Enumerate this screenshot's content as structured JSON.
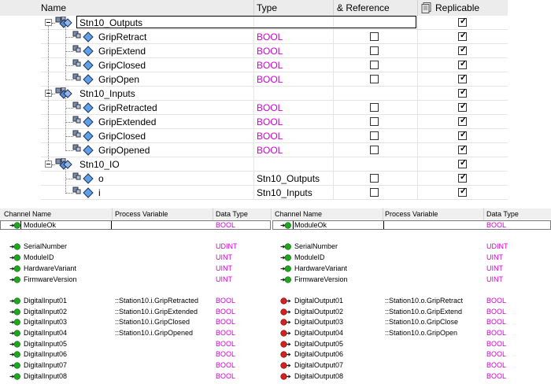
{
  "tree": {
    "headers": {
      "name": "Name",
      "type": "Type",
      "reference": "& Reference",
      "replicable": "Replicable"
    },
    "rows": [
      {
        "kind": "group",
        "name": "Stn10_Outputs",
        "type": "",
        "reference": null,
        "replicable": true,
        "editing": true
      },
      {
        "kind": "var",
        "name": "GripRetract",
        "type": "BOOL",
        "reference": false,
        "replicable": true
      },
      {
        "kind": "var",
        "name": "GripExtend",
        "type": "BOOL",
        "reference": false,
        "replicable": true
      },
      {
        "kind": "var",
        "name": "GripClosed",
        "type": "BOOL",
        "reference": false,
        "replicable": true
      },
      {
        "kind": "var",
        "name": "GripOpen",
        "type": "BOOL",
        "reference": false,
        "replicable": true
      },
      {
        "kind": "group",
        "name": "Stn10_Inputs",
        "type": "",
        "reference": null,
        "replicable": true
      },
      {
        "kind": "var",
        "name": "GripRetracted",
        "type": "BOOL",
        "reference": false,
        "replicable": true
      },
      {
        "kind": "var",
        "name": "GripExtended",
        "type": "BOOL",
        "reference": false,
        "replicable": true
      },
      {
        "kind": "var",
        "name": "GripClosed",
        "type": "BOOL",
        "reference": false,
        "replicable": true
      },
      {
        "kind": "var",
        "name": "GripOpened",
        "type": "BOOL",
        "reference": false,
        "replicable": true
      },
      {
        "kind": "group",
        "name": "Stn10_IO",
        "type": "",
        "reference": null,
        "replicable": true
      },
      {
        "kind": "var",
        "name": "o",
        "type": "Stn10_Outputs",
        "reference": false,
        "replicable": true
      },
      {
        "kind": "var",
        "name": "i",
        "type": "Stn10_Inputs",
        "reference": false,
        "replicable": true
      }
    ]
  },
  "channels": {
    "headers": {
      "channel": "Channel Name",
      "process": "Process Variable",
      "datatype": "Data Type"
    },
    "left": [
      {
        "channel": "ModuleOk",
        "process": "",
        "type": "BOOL",
        "arrow": "green-in",
        "selected": true
      },
      null,
      {
        "channel": "SerialNumber",
        "process": "",
        "type": "UDINT",
        "arrow": "green-in"
      },
      {
        "channel": "ModuleID",
        "process": "",
        "type": "UINT",
        "arrow": "green-in"
      },
      {
        "channel": "HardwareVariant",
        "process": "",
        "type": "UINT",
        "arrow": "green-in"
      },
      {
        "channel": "FirmwareVersion",
        "process": "",
        "type": "UINT",
        "arrow": "green-in"
      },
      null,
      {
        "channel": "DigitalInput01",
        "process": "::Station10.i.GripRetracted",
        "type": "BOOL",
        "arrow": "green-in"
      },
      {
        "channel": "DigitalInput02",
        "process": "::Station10.i.GripExtended",
        "type": "BOOL",
        "arrow": "green-in"
      },
      {
        "channel": "DigitalInput03",
        "process": "::Station10.i.GripClosed",
        "type": "BOOL",
        "arrow": "green-in"
      },
      {
        "channel": "DigitalInput04",
        "process": "::Station10.i.GripOpened",
        "type": "BOOL",
        "arrow": "green-in"
      },
      {
        "channel": "DigitalInput05",
        "process": "",
        "type": "BOOL",
        "arrow": "green-in"
      },
      {
        "channel": "DigitalInput06",
        "process": "",
        "type": "BOOL",
        "arrow": "green-in"
      },
      {
        "channel": "DigitalInput07",
        "process": "",
        "type": "BOOL",
        "arrow": "green-in"
      },
      {
        "channel": "DigitalInput08",
        "process": "",
        "type": "BOOL",
        "arrow": "green-in"
      }
    ],
    "right": [
      {
        "channel": "ModuleOk",
        "process": "",
        "type": "BOOL",
        "arrow": "green-in",
        "selected": true
      },
      null,
      {
        "channel": "SerialNumber",
        "process": "",
        "type": "UDINT",
        "arrow": "green-in"
      },
      {
        "channel": "ModuleID",
        "process": "",
        "type": "UINT",
        "arrow": "green-in"
      },
      {
        "channel": "HardwareVariant",
        "process": "",
        "type": "UINT",
        "arrow": "green-in"
      },
      {
        "channel": "FirmwareVersion",
        "process": "",
        "type": "UINT",
        "arrow": "green-in"
      },
      null,
      {
        "channel": "DigitalOutput01",
        "process": "::Station10.o.GripRetract",
        "type": "BOOL",
        "arrow": "red-out"
      },
      {
        "channel": "DigitalOutput02",
        "process": "::Station10.o.GripExtend",
        "type": "BOOL",
        "arrow": "red-out"
      },
      {
        "channel": "DigitalOutput03",
        "process": "::Station10.o.GripClose",
        "type": "BOOL",
        "arrow": "red-out"
      },
      {
        "channel": "DigitalOutput04",
        "process": "::Station10.o.GripOpen",
        "type": "BOOL",
        "arrow": "red-out"
      },
      {
        "channel": "DigitalOutput05",
        "process": "",
        "type": "BOOL",
        "arrow": "red-out"
      },
      {
        "channel": "DigitalOutput06",
        "process": "",
        "type": "BOOL",
        "arrow": "red-out"
      },
      {
        "channel": "DigitalOutput07",
        "process": "",
        "type": "BOOL",
        "arrow": "red-out"
      },
      {
        "channel": "DigitalOutput08",
        "process": "",
        "type": "BOOL",
        "arrow": "red-out"
      }
    ]
  },
  "colors": {
    "type_text": "#d100d1",
    "grid": "#e4e4e4",
    "green_arrow": "#1fa81f",
    "red_arrow": "#d42020"
  }
}
